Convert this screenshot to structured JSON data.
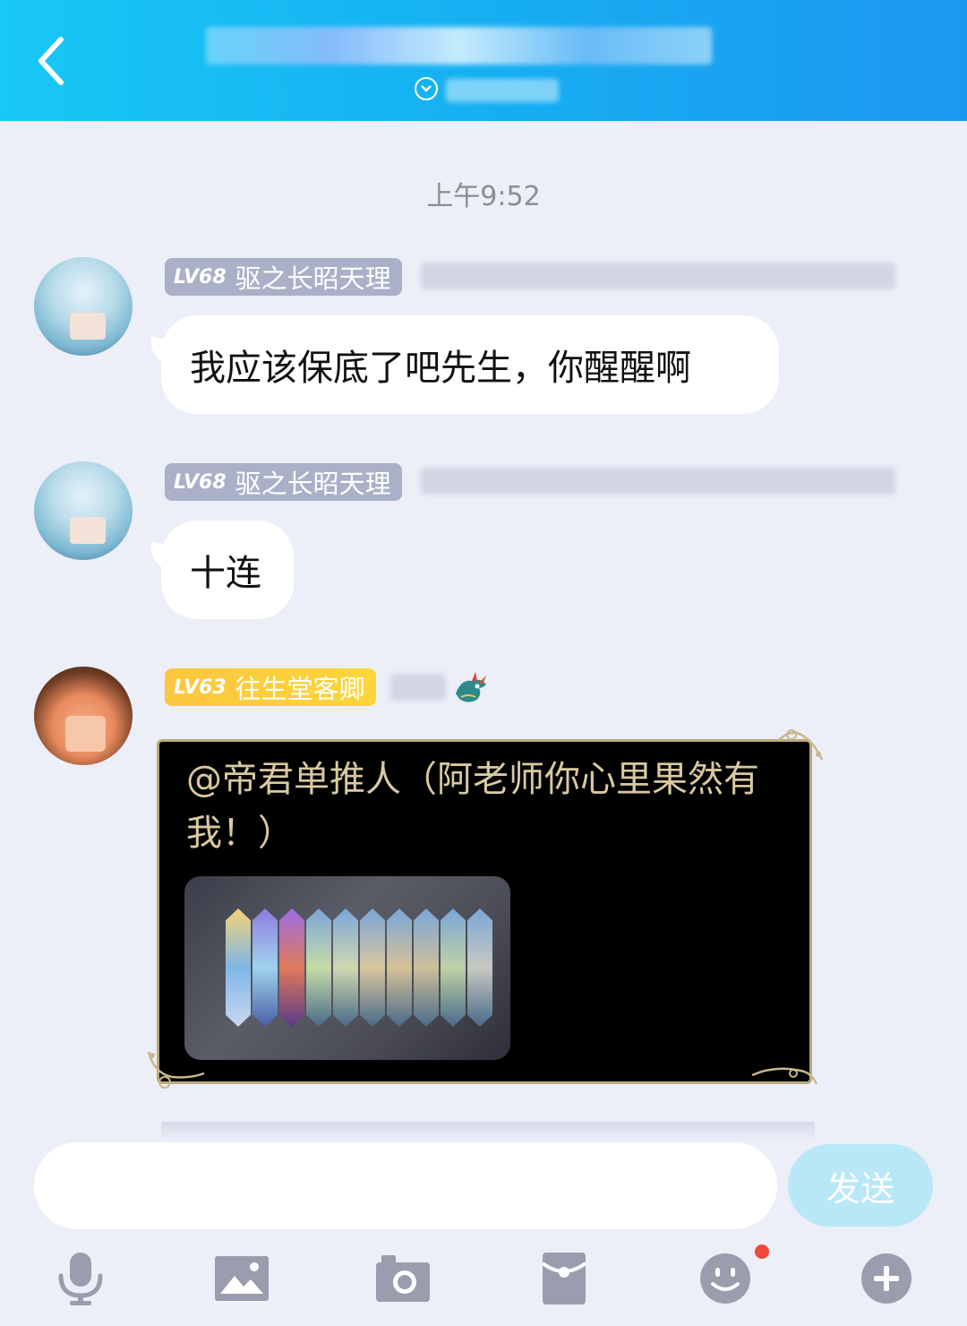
{
  "header": {
    "title_blurred": true,
    "subtitle_blurred": true
  },
  "chat": {
    "timestamp": "上午9:52",
    "messages": [
      {
        "level": "LV68",
        "title": "驱之长昭天理",
        "badge_color": "#aab0c7",
        "text": "我应该保底了吧先生，你醒醒啊"
      },
      {
        "level": "LV68",
        "title": "驱之长昭天理",
        "badge_color": "#aab0c7",
        "text": "十连"
      },
      {
        "level": "LV63",
        "title": "往生堂客卿",
        "badge_color": "#fcc63e",
        "text": " @帝君单推人（阿老师你心里果然有我！）",
        "has_image": true
      }
    ]
  },
  "input": {
    "placeholder": "",
    "send_label": "发送"
  },
  "toolbar": {
    "icons": [
      "microphone-icon",
      "image-icon",
      "camera-icon",
      "red-packet-icon",
      "emoji-icon",
      "plus-icon"
    ],
    "emoji_has_notification": true
  },
  "colors": {
    "header_gradient_start": "#18c8f5",
    "header_gradient_end": "#1c97f0",
    "background": "#eceef8",
    "send_button": "#b8e8f8",
    "icon_gray": "#9a9dae",
    "notification": "#f2493c"
  }
}
